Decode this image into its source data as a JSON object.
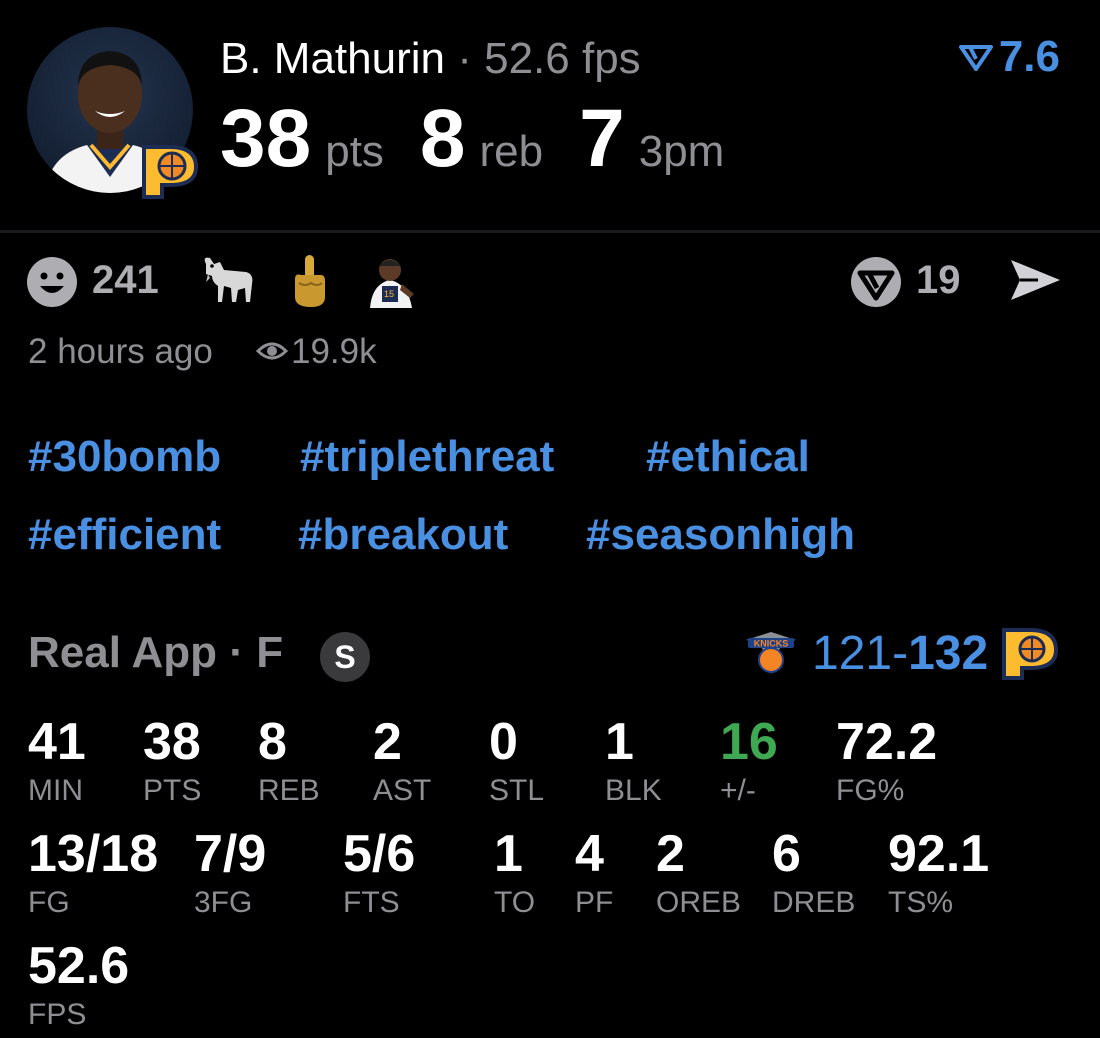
{
  "header": {
    "player_name": "B. Mathurin",
    "separator": "·",
    "fps_text": "52.6 fps",
    "rating": "7.6",
    "stats": [
      {
        "value": "38",
        "unit": "pts"
      },
      {
        "value": "8",
        "unit": "reb"
      },
      {
        "value": "7",
        "unit": "3pm"
      }
    ]
  },
  "reactions": {
    "count": "241",
    "icons": [
      "smiley-icon",
      "goat-icon",
      "middle-finger-icon",
      "player-emoji-icon"
    ],
    "brand_count": "19",
    "time_ago": "2 hours ago",
    "views": "19.9k"
  },
  "hashtags": [
    [
      "#30bomb",
      "#triplethreat",
      "#ethical"
    ],
    [
      "#efficient",
      "#breakout",
      "#seasonhigh"
    ]
  ],
  "game": {
    "source": "Real App",
    "dot": "·",
    "status": "F",
    "badge": "S",
    "away_score": "121",
    "dash": "-",
    "home_score": "132"
  },
  "box_score": [
    [
      {
        "value": "41",
        "label": "MIN"
      },
      {
        "value": "38",
        "label": "PTS"
      },
      {
        "value": "8",
        "label": "REB"
      },
      {
        "value": "2",
        "label": "AST"
      },
      {
        "value": "0",
        "label": "STL"
      },
      {
        "value": "1",
        "label": "BLK"
      },
      {
        "value": "16",
        "label": "+/-"
      },
      {
        "value": "72.2",
        "label": "FG%"
      }
    ],
    [
      {
        "value": "13/18",
        "label": "FG"
      },
      {
        "value": "7/9",
        "label": "3FG"
      },
      {
        "value": "5/6",
        "label": "FTS"
      },
      {
        "value": "1",
        "label": "TO"
      },
      {
        "value": "4",
        "label": "PF"
      },
      {
        "value": "2",
        "label": "OREB"
      },
      {
        "value": "6",
        "label": "DREB"
      },
      {
        "value": "92.1",
        "label": "TS%"
      }
    ],
    [
      {
        "value": "52.6",
        "label": "FPS"
      }
    ]
  ],
  "colors": {
    "background": "#000000",
    "accent_blue": "#4a90e2",
    "muted_gray": "#8e8e93",
    "positive_green": "#3ea852"
  }
}
